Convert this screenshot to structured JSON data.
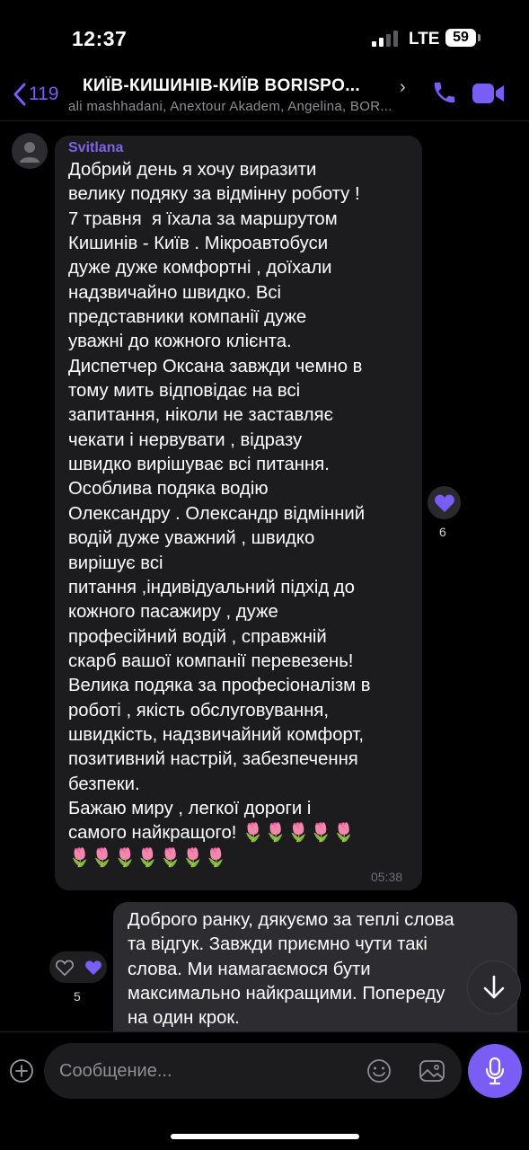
{
  "status_bar": {
    "time": "12:37",
    "network": "LTE",
    "battery": "59"
  },
  "header": {
    "back_count": "119",
    "title": "КИЇВ-КИШИНІВ-КИЇВ BORISPO...",
    "subtitle": "ali mashhadani, Anextour Akadem, Angelina, BOR..."
  },
  "messages": {
    "incoming": {
      "sender": "Svitlana",
      "text": "Добрий день я хочу виразити\nвелику подяку за відмінну роботу !\n7 травня  я їхала за маршрутом\nКишинів - Київ . Мікроавтобуси\nдуже дуже комфортні , доїхали\nнадзвичайно швидко. Всі\nпредставники компанії дуже\nуважні до кожного клієнта.\nДиспетчер Оксана завжди чемно в\nтому мить відповідає на всі\nзапитання, ніколи не заставляє\nчекати і нервувати , відразу\nшвидко вирішуває всі питання.\nОсоблива подяка водію\nОлександру . Олександр відмінний\nводій дуже уважний , швидко\nвирішує всі\nпитання ,індивідуальний підхід до\nкожного пасажиру , дуже\nпрофесійний водій , справжній\nскарб вашої компанії перевезень!\nВелика подяка за професіоналізм в\nроботі , якість обслуговування,\nшвидкість, надзвичайний комфорт,\nпозитивний настрій, забезпечення\nбезпеки.\nБажаю миру , легкої дороги і\nсамого найкращого! 🌷🌷🌷🌷🌷\n🌷🌷🌷🌷🌷🌷🌷",
      "time": "05:38",
      "reaction_count": "6"
    },
    "outgoing": {
      "text": "Доброго ранку, дякуємо за теплі слова\nта відгук. Завжди приємно чути такі\nслова. Ми намагаємося бути\nмаксимально найкращими. Попереду\nна один крок.",
      "reaction_count": "5"
    }
  },
  "composer": {
    "placeholder": "Сообщение..."
  },
  "colors": {
    "accent": "#7a5df4",
    "sender": "#7d63e6",
    "bubble_in": "#1c1c1f",
    "bubble_out": "#2c2c31"
  }
}
